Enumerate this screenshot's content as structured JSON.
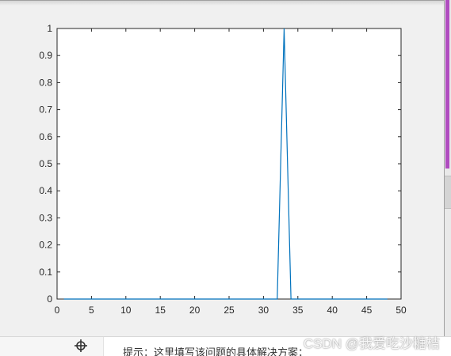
{
  "chart_data": {
    "type": "line",
    "title": "",
    "xlabel": "",
    "ylabel": "",
    "xlim": [
      0,
      50
    ],
    "ylim": [
      0,
      1
    ],
    "x_ticks": [
      "0",
      "5",
      "10",
      "15",
      "20",
      "25",
      "30",
      "35",
      "40",
      "45",
      "50"
    ],
    "y_ticks": [
      "0",
      "0.1",
      "0.2",
      "0.3",
      "0.4",
      "0.5",
      "0.6",
      "0.7",
      "0.8",
      "0.9",
      "1"
    ],
    "series": [
      {
        "color": "#0072bd",
        "x": [
          1,
          32,
          33,
          34,
          48
        ],
        "y": [
          0,
          0,
          1,
          0,
          0
        ]
      }
    ],
    "grid": false,
    "legend": "none"
  },
  "footer": {
    "hint": "提示：这里填写该问题的具体解决方案：",
    "watermark": "CSDN @我爱吃沙糖桔"
  },
  "icons": {
    "anchor": "move-anchor-icon"
  }
}
